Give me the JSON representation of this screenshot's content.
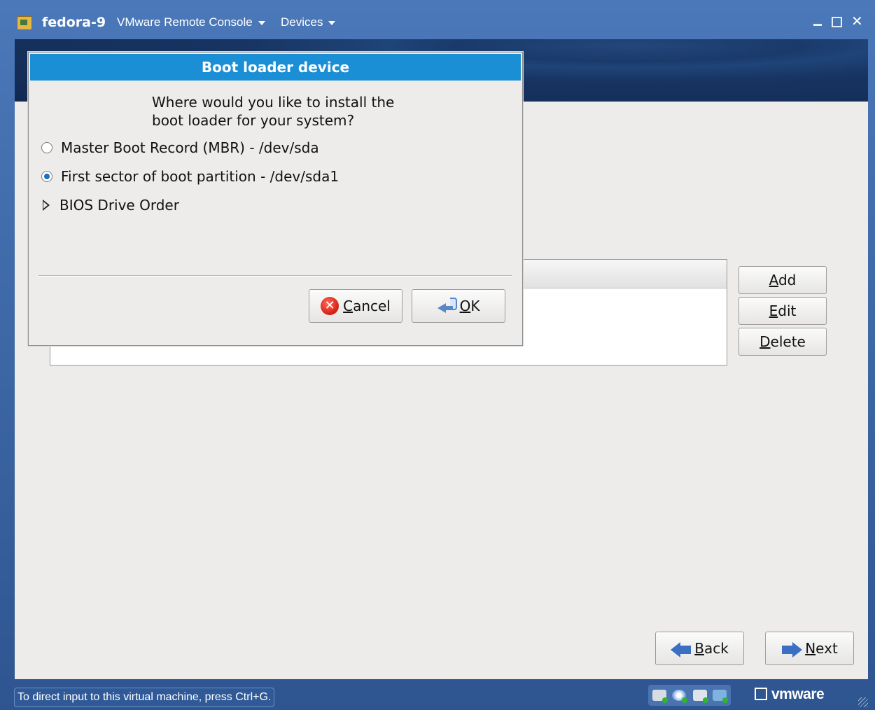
{
  "window": {
    "vm_name": "fedora-9",
    "app_title": "VMware Remote Console",
    "menu_devices": "Devices"
  },
  "dialog": {
    "title": "Boot loader device",
    "question_line1": "Where would you like to install the",
    "question_line2": "boot loader for your system?",
    "options": [
      {
        "label": "Master Boot Record (MBR) - /dev/sda",
        "selected": false
      },
      {
        "label": "First sector of boot partition - /dev/sda1",
        "selected": true
      }
    ],
    "expander_label": "BIOS Drive Order",
    "cancel_label": {
      "mnemonic": "C",
      "rest": "ancel"
    },
    "ok_label": {
      "mnemonic": "O",
      "rest": "K"
    }
  },
  "side_buttons": {
    "add": {
      "mnemonic": "A",
      "rest": "dd"
    },
    "edit": {
      "mnemonic": "E",
      "rest": "dit"
    },
    "delete": {
      "mnemonic": "D",
      "rest": "elete"
    }
  },
  "nav": {
    "back": {
      "mnemonic": "B",
      "rest": "ack"
    },
    "next": {
      "mnemonic": "N",
      "rest": "ext"
    }
  },
  "statusbar": {
    "message": "To direct input to this virtual machine, press Ctrl+G.",
    "brand": "vmware"
  },
  "colors": {
    "titlebar": "#3f6aa8",
    "dialog_title_bg": "#1a8fd6",
    "banner": "#1a3a6b"
  }
}
